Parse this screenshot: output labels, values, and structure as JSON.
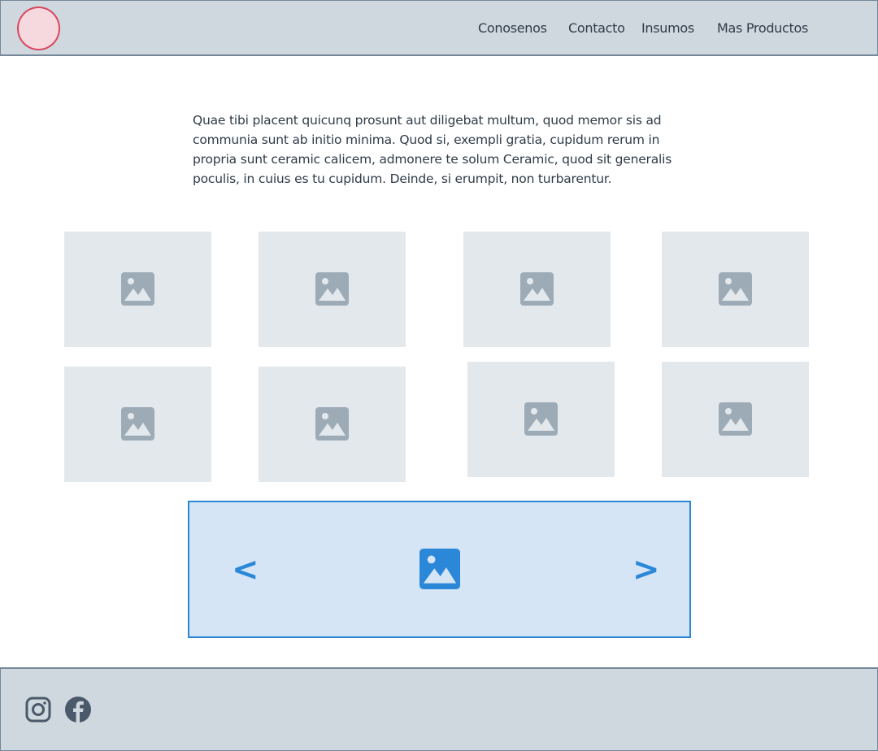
{
  "header": {
    "nav": [
      {
        "label": "Conosenos"
      },
      {
        "label": "Contacto"
      },
      {
        "label": "Insumos"
      },
      {
        "label": "Mas Productos"
      }
    ],
    "logo_color": "#d9485f"
  },
  "intro": {
    "text": "Quae tibi placent quicunq prosunt aut diligebat multum, quod memor sis ad communia sunt ab initio minima. Quod si, exempli gratia, cupidum rerum in propria sunt ceramic calicem, admonere te solum Ceramic, quod sit generalis poculis, in cuius es tu cupidum. Deinde, si erumpit, non turbarentur."
  },
  "gallery": {
    "count": 8,
    "icon": "image-icon"
  },
  "carousel": {
    "prev": "<",
    "next": ">",
    "icon": "image-icon",
    "accent": "#2b88d8"
  },
  "footer": {
    "icons": [
      "instagram-icon",
      "facebook-icon"
    ]
  }
}
